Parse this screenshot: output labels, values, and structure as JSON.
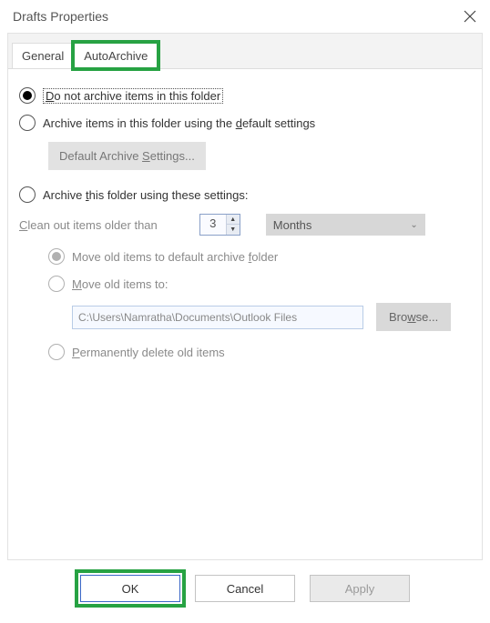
{
  "title": "Drafts Properties",
  "tabs": {
    "general": "General",
    "autoarchive": "AutoArchive"
  },
  "opt_no_archive_pre": "D",
  "opt_no_archive_rest": "o not archive items in this folder",
  "opt_default_pre": "Archive items in this folder using the ",
  "opt_default_ul": "d",
  "opt_default_post": "efault settings",
  "default_btn_pre": "Default Archive ",
  "default_btn_ul": "S",
  "default_btn_post": "ettings...",
  "opt_these_pre": "Archive ",
  "opt_these_ul": "t",
  "opt_these_post": "his folder using these settings:",
  "clean_ul": "C",
  "clean_post": "lean out items older than",
  "clean_value": "3",
  "unit": "Months",
  "move_default_pre": "Move old items to default archive ",
  "move_default_ul": "f",
  "move_default_post": "older",
  "move_to_ul": "M",
  "move_to_post": "ove old items to:",
  "path": "C:\\Users\\Namratha\\Documents\\Outlook Files",
  "browse_pre": "Bro",
  "browse_ul": "w",
  "browse_post": "se...",
  "perm_ul": "P",
  "perm_post": "ermanently delete old items",
  "buttons": {
    "ok": "OK",
    "cancel": "Cancel",
    "apply": "Apply"
  }
}
